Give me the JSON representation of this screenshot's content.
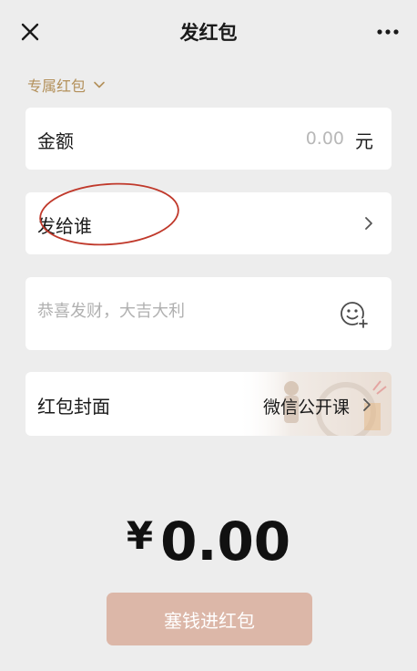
{
  "header": {
    "title": "发红包",
    "close_icon": "close-icon",
    "more_icon": "more-dots-icon"
  },
  "packet_type": {
    "label": "专属红包",
    "icon": "chevron-down-icon",
    "color": "#b3905a"
  },
  "amount": {
    "label": "金额",
    "placeholder": "0.00",
    "unit": "元"
  },
  "recipient": {
    "label": "发给谁",
    "icon": "chevron-right-icon"
  },
  "message": {
    "placeholder": "恭喜发财，大吉大利",
    "icon": "emoji-add-icon"
  },
  "cover": {
    "label": "红包封面",
    "value": "微信公开课",
    "icon": "chevron-right-icon"
  },
  "total": {
    "currency": "¥",
    "value": "0.00"
  },
  "submit": {
    "label": "塞钱进红包",
    "color": "#dcb7a8"
  },
  "colors": {
    "background": "#ededed",
    "annotation": "#c0392b"
  }
}
